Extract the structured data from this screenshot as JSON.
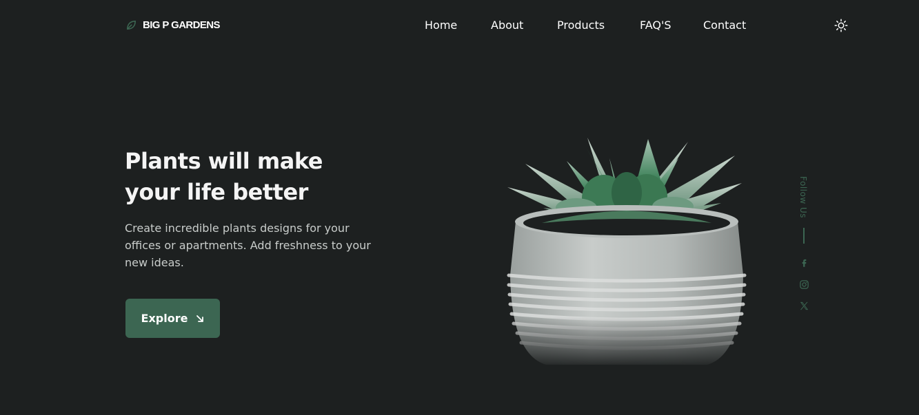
{
  "brand": {
    "name": "BIG P GARDENS",
    "accent_color": "#3c6652",
    "background_color": "#1d2020"
  },
  "nav": {
    "items": [
      {
        "label": "Home"
      },
      {
        "label": "About"
      },
      {
        "label": "Products"
      },
      {
        "label": "FAQ'S"
      },
      {
        "label": "Contact"
      }
    ],
    "theme_toggle_icon": "sun-icon"
  },
  "hero": {
    "title_line1": "Plants will make",
    "title_line2": "your life better",
    "description": "Create incredible plants designs for your offices or apartments. Add freshness to your new ideas.",
    "cta_label": "Explore",
    "cta_icon": "arrow-down-right-icon",
    "image": "succulent-in-concrete-pot"
  },
  "social": {
    "label": "Follow Us",
    "icons": [
      "facebook-icon",
      "instagram-icon",
      "x-twitter-icon"
    ]
  }
}
